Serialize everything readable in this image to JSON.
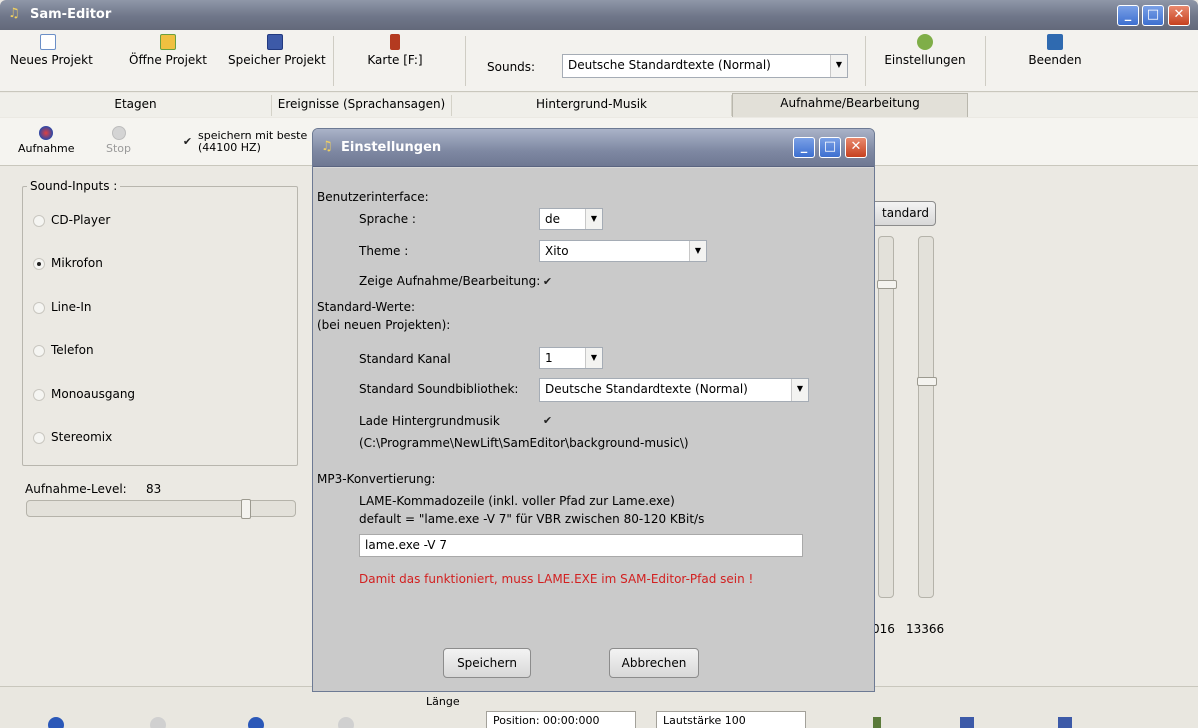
{
  "window": {
    "title": "Sam-Editor"
  },
  "toolbar": {
    "new_project": "Neues Projekt",
    "open_project": "Öffne Projekt",
    "save_project": "Speicher Projekt",
    "card": "Karte [F:]",
    "sounds_label": "Sounds:",
    "sounds_value": "Deutsche Standardtexte (Normal)",
    "settings": "Einstellungen",
    "exit": "Beenden"
  },
  "tabs": [
    "Etagen",
    "Ereignisse (Sprachansagen)",
    "Hintergrund-Musik",
    "Aufnahme/Bearbeitung"
  ],
  "recording": {
    "record": "Aufnahme",
    "stop": "Stop",
    "save_best_line1": "speichern mit beste",
    "save_best_line2": "(44100 HZ)",
    "standard_button": "tandard"
  },
  "sound_inputs": {
    "legend": "Sound-Inputs :",
    "options": [
      "CD-Player",
      "Mikrofon",
      "Line-In",
      "Telefon",
      "Monoausgang",
      "Stereomix"
    ],
    "selected": "Mikrofon"
  },
  "level": {
    "label": "Aufnahme-Level:",
    "value": "83",
    "fraction": 0.83
  },
  "right_values": {
    "a": "016",
    "b": "13366"
  },
  "statusbar": {
    "laenge": "Länge",
    "position_label": "Position:",
    "position_value": "00:00:000",
    "volume_label": "Lautstärke",
    "volume_value": "100"
  },
  "dialog": {
    "title": "Einstellungen",
    "ui_heading": "Benutzerinterface:",
    "language_label": "Sprache :",
    "language_value": "de",
    "theme_label": "Theme :",
    "theme_value": "Xito",
    "show_rec_label": "Zeige Aufnahme/Bearbeitung:",
    "defaults_heading": "Standard-Werte:",
    "defaults_sub": "(bei neuen Projekten):",
    "channel_label": "Standard Kanal",
    "channel_value": "1",
    "library_label": "Standard Soundbibliothek:",
    "library_value": "Deutsche Standardtexte (Normal)",
    "bg_music_label": "Lade Hintergrundmusik",
    "bg_music_path": "(C:\\Programme\\NewLift\\SamEditor\\background-music\\)",
    "mp3_heading": "MP3-Konvertierung:",
    "lame_desc": "LAME-Kommadozeile (inkl. voller Pfad zur Lame.exe)",
    "lame_default": "default = \"lame.exe -V 7\"   für  VBR zwischen 80-120 KBit/s",
    "lame_value": "lame.exe -V 7",
    "warning": "Damit das funktioniert, muss LAME.EXE im SAM-Editor-Pfad sein !",
    "save": "Speichern",
    "cancel": "Abbrechen"
  },
  "colors": {
    "warning": "#d22020",
    "title_gradient": "#7e88a2"
  }
}
